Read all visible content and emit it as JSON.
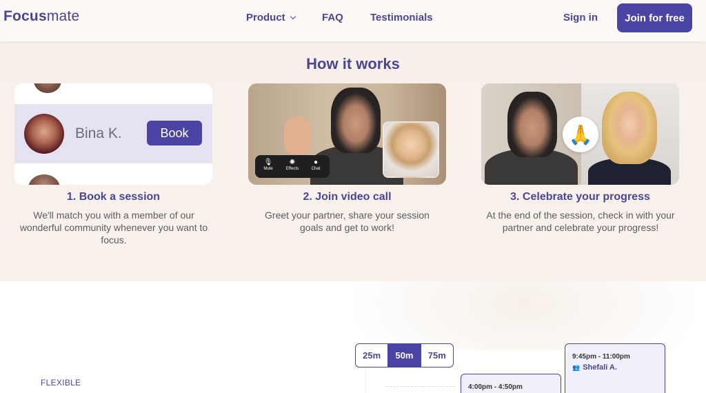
{
  "header": {
    "logo_bold": "Focus",
    "logo_light": "mate",
    "nav": {
      "product": "Product",
      "faq": "FAQ",
      "testimonials": "Testimonials"
    },
    "sign_in": "Sign in",
    "join": "Join for free"
  },
  "how_it_works": {
    "title": "How it works",
    "steps": [
      {
        "title": "1. Book a session",
        "desc": "We'll match you with a member of our wonderful community whenever you want to focus."
      },
      {
        "title": "2. Join video call",
        "desc": "Greet your partner, share your session goals and get to work!"
      },
      {
        "title": "3. Celebrate your progress",
        "desc": "At the end of the session, check in with your partner and celebrate your progress!"
      }
    ],
    "booking": {
      "name": "Bina K.",
      "button": "Book"
    },
    "call_controls": [
      "Mute",
      "Effects",
      "Chat"
    ],
    "celebrate_emoji": "🙏"
  },
  "lower": {
    "label": "FLEXIBLE",
    "durations": [
      "25m",
      "50m",
      "75m"
    ],
    "active_duration": "50m",
    "slots": [
      {
        "time": "9:45pm - 11:00pm",
        "name": "Shefali A."
      },
      {
        "time": "4:00pm - 4:50pm"
      }
    ]
  },
  "colors": {
    "brand": "#4a44a5",
    "brand_text": "#4a4594"
  }
}
